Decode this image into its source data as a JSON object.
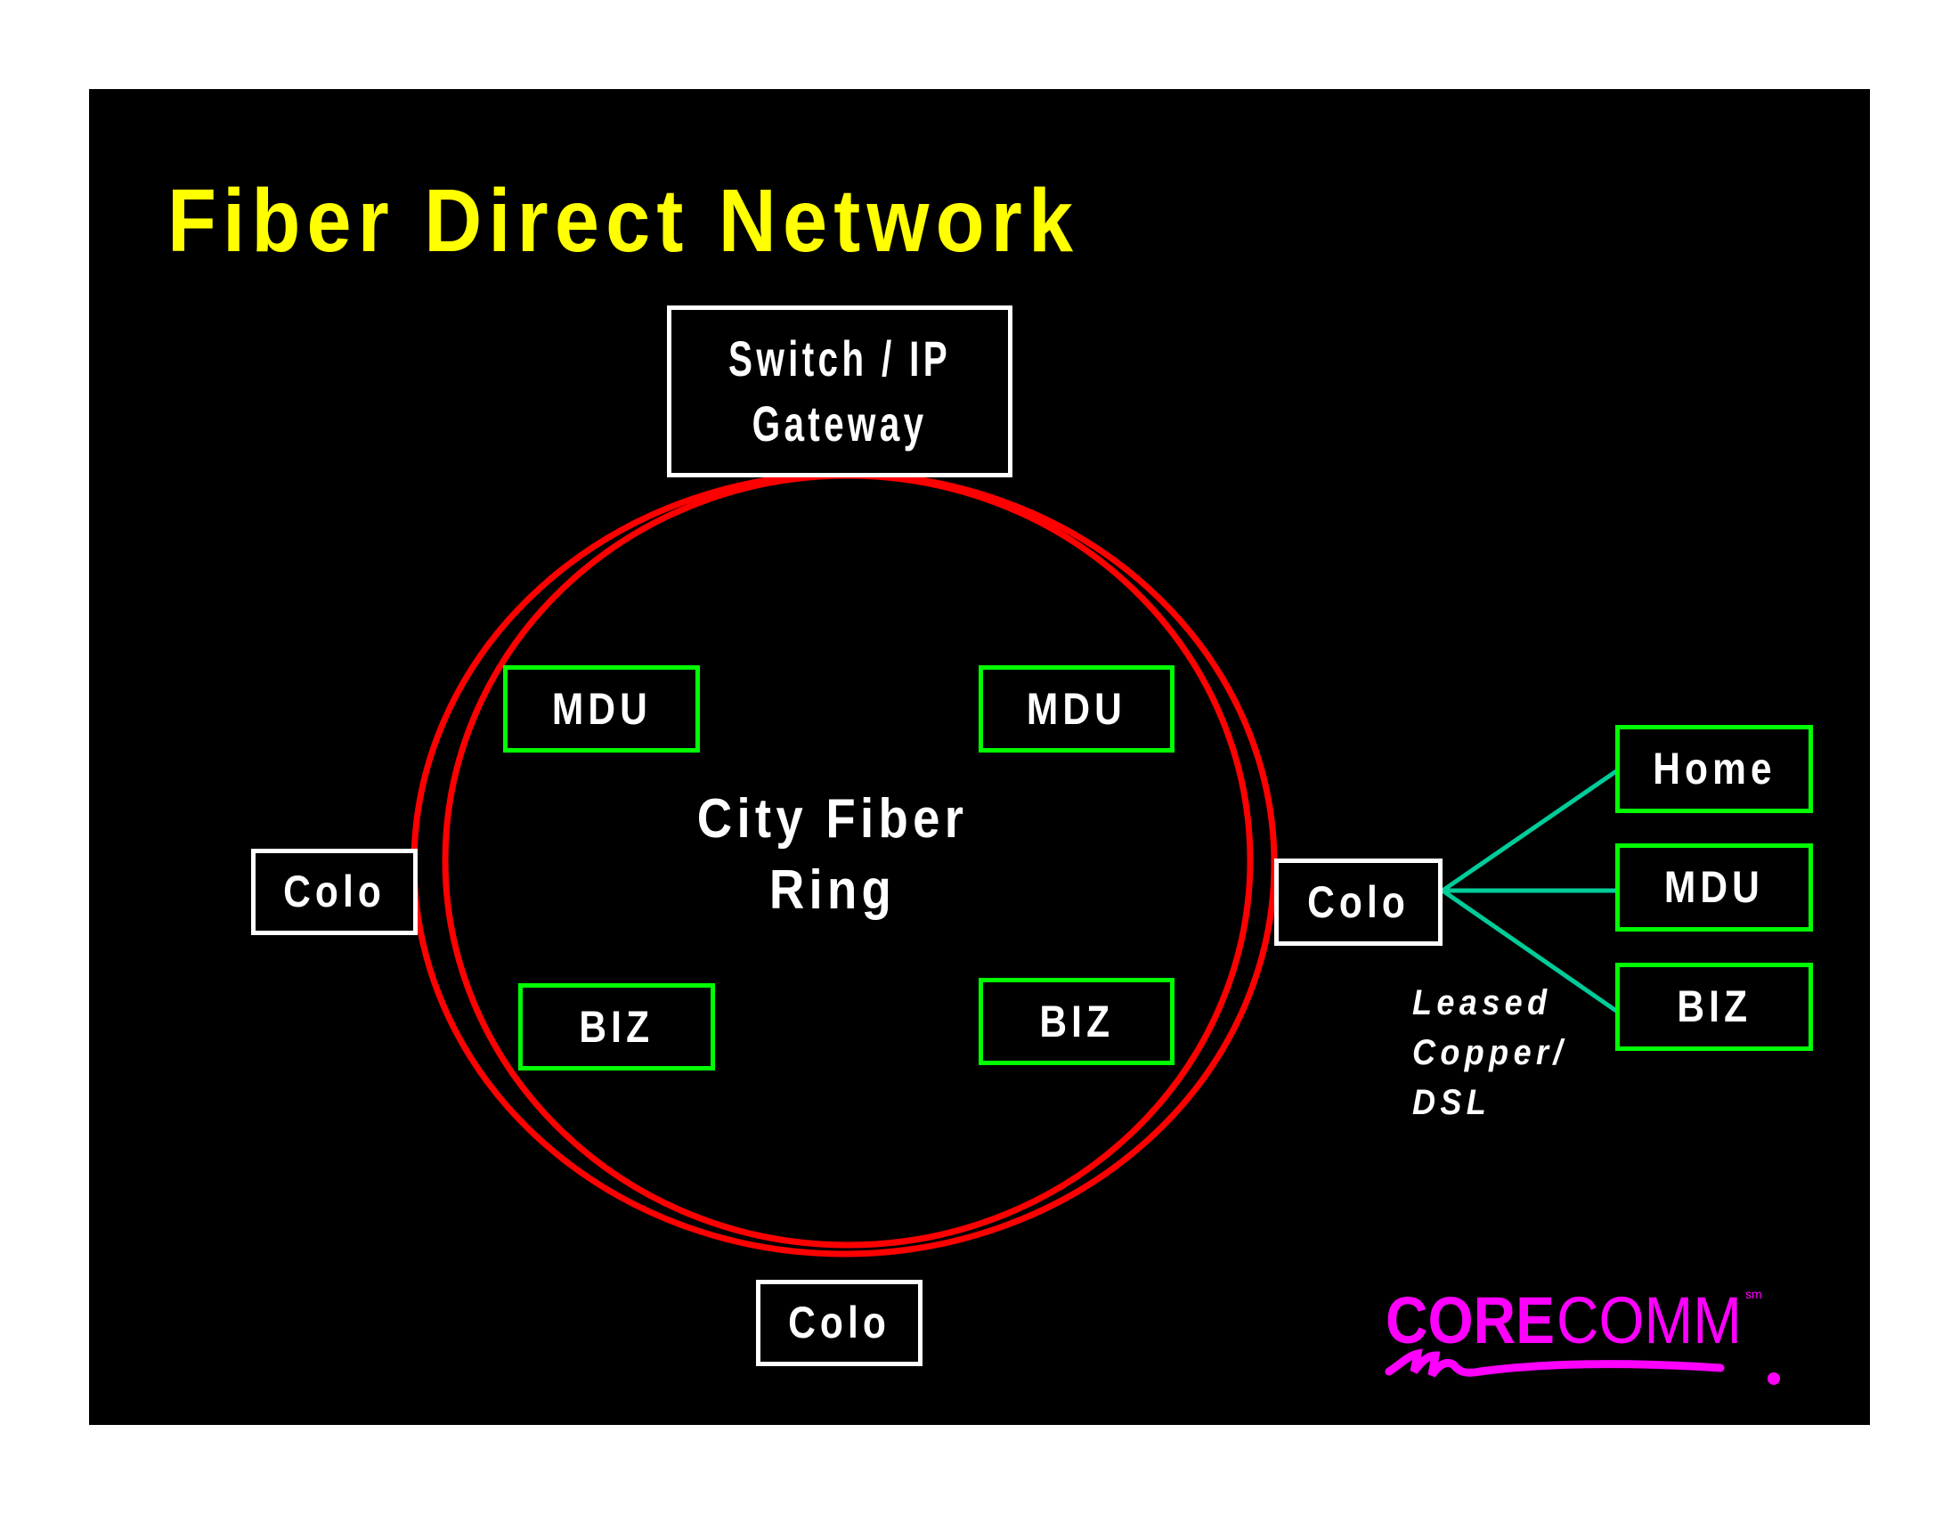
{
  "slide": {
    "title": "Fiber Direct Network",
    "colors": {
      "background": "#000000",
      "title": "#ffff00",
      "ring": "#ff0000",
      "node_border_white": "#ffffff",
      "node_border_green": "#00ff00",
      "copper_link": "#00cc99",
      "logo": "#ff00ff"
    }
  },
  "gateway": {
    "line1": "Switch / IP",
    "line2": "Gateway"
  },
  "ring": {
    "line1": "City Fiber",
    "line2": "Ring"
  },
  "ring_nodes": {
    "mdu_left": "MDU",
    "mdu_right": "MDU",
    "biz_left": "BIZ",
    "biz_right": "BIZ"
  },
  "colo": {
    "left": "Colo",
    "right": "Colo",
    "bottom": "Colo"
  },
  "branch": {
    "home": "Home",
    "mdu": "MDU",
    "biz": "BIZ",
    "link_label": [
      "Leased",
      "Copper/",
      "DSL"
    ]
  },
  "logo": {
    "bold_part": "CORE",
    "light_part": "COMM",
    "mark": "sm"
  }
}
